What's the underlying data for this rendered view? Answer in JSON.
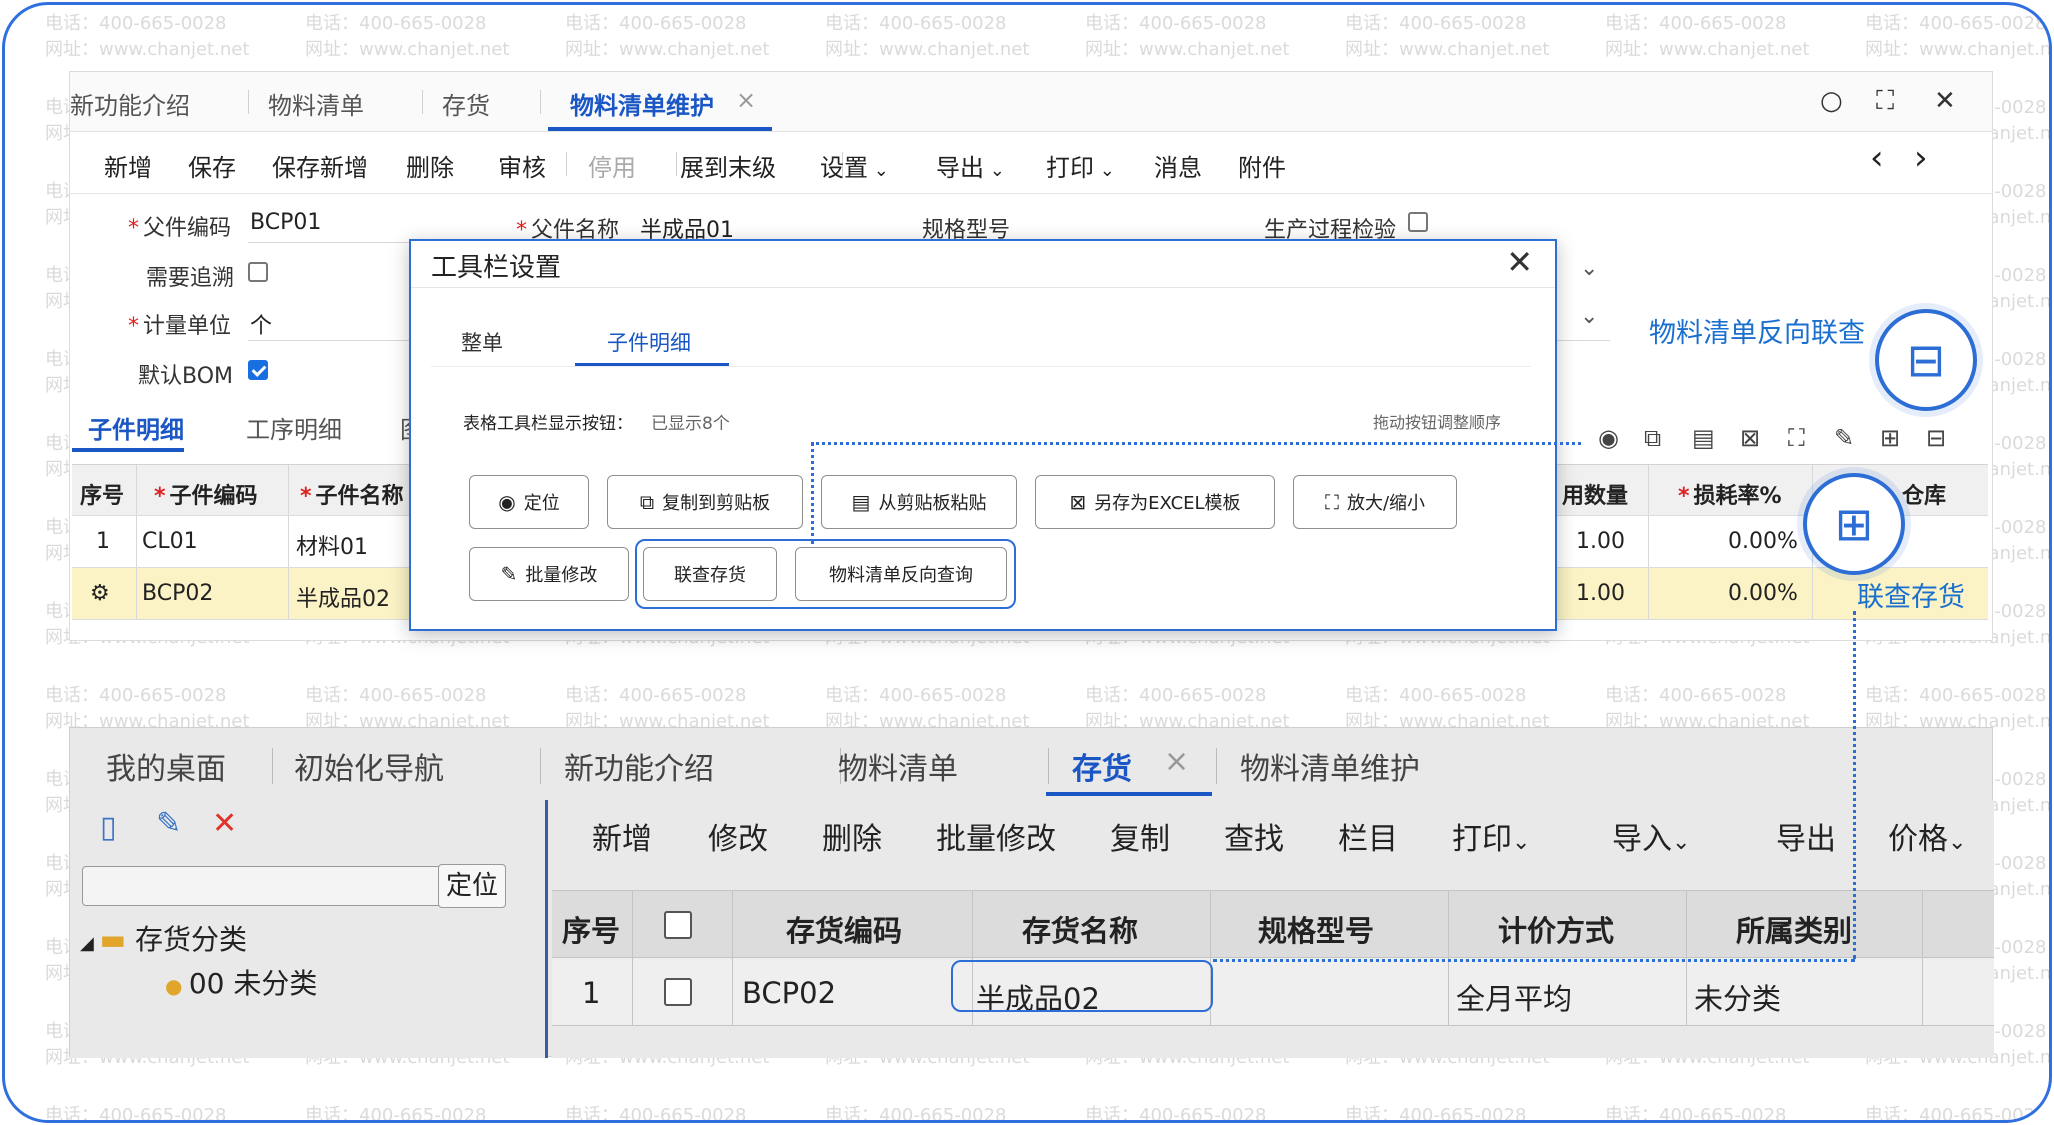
{
  "watermark": {
    "phone": "电话：400-665-0028",
    "site": "网址：www.chanjet.net"
  },
  "top": {
    "tabs": [
      {
        "label": "新功能介绍"
      },
      {
        "label": "物料清单"
      },
      {
        "label": "存货"
      },
      {
        "label": "物料清单维护",
        "active": true
      }
    ],
    "tab_close": "×",
    "window_icons": {
      "search": "○",
      "expand": "⛶",
      "close": "✕"
    },
    "toolbar": [
      "新增",
      "保存",
      "保存新增",
      "删除",
      "审核",
      "停用",
      "展到末级",
      "设置",
      "导出",
      "打印",
      "消息",
      "附件"
    ],
    "toolbar_nav": {
      "prev": "‹",
      "next": "›"
    },
    "form": {
      "parent_code_label": "父件编码",
      "parent_code": "BCP01",
      "parent_name_label": "父件名称",
      "parent_name": "半成品01",
      "spec_label": "规格型号",
      "process_check_label": "生产过程检验",
      "trace_label": "需要追溯",
      "unit_label": "计量单位",
      "unit": "个",
      "default_bom_label": "默认BOM"
    },
    "subtabs": [
      "子件明细",
      "工序明细",
      "图"
    ],
    "grid": {
      "headers": [
        "序号",
        "子件编码",
        "子件名称",
        "用数量",
        "损耗率%",
        "仓库"
      ],
      "rows": [
        {
          "seq": "1",
          "code": "CL01",
          "name": "材料01",
          "qty": "1.00",
          "loss": "0.00%"
        },
        {
          "seq": "",
          "code": "BCP02",
          "name": "半成品02",
          "qty": "1.00",
          "loss": "0.00%"
        }
      ]
    }
  },
  "dialog": {
    "title": "工具栏设置",
    "close": "✕",
    "tabs": [
      "整单",
      "子件明细"
    ],
    "desc_label": "表格工具栏显示按钮：",
    "desc_count": "已显示8个",
    "hint": "拖动按钮调整顺序",
    "buttons": [
      {
        "label": "定位",
        "icon": "◉"
      },
      {
        "label": "复制到剪贴板",
        "icon": "⧉"
      },
      {
        "label": "从剪贴板粘贴",
        "icon": "📋"
      },
      {
        "label": "另存为EXCEL模板",
        "icon": "⊠"
      },
      {
        "label": "放大/缩小",
        "icon": "⛶"
      },
      {
        "label": "批量修改",
        "icon": "✎"
      },
      {
        "label": "联查存货",
        "icon": ""
      },
      {
        "label": "物料清单反向查询",
        "icon": ""
      }
    ]
  },
  "bottom": {
    "tabs": [
      "我的桌面",
      "初始化导航",
      "新功能介绍",
      "物料清单",
      "存货",
      "物料清单维护"
    ],
    "tab_close": "×",
    "toolbar": [
      "新增",
      "修改",
      "删除",
      "批量修改",
      "复制",
      "查找",
      "栏目",
      "打印",
      "导入",
      "导出",
      "价格"
    ],
    "find_button": "定位",
    "tree": {
      "root": "存货分类",
      "child": "00 未分类"
    },
    "grid": {
      "headers": [
        "序号",
        "存货编码",
        "存货名称",
        "规格型号",
        "计价方式",
        "所属类别"
      ],
      "row": {
        "seq": "1",
        "code": "BCP02",
        "name": "半成品02",
        "spec": "",
        "pricing": "全月平均",
        "category": "未分类"
      }
    }
  },
  "callouts": {
    "bom_reverse": "物料清单反向联查",
    "inventory": "联查存货"
  },
  "colors": {
    "accent": "#2d6ed6",
    "highlight_row": "#fbf3c6"
  }
}
